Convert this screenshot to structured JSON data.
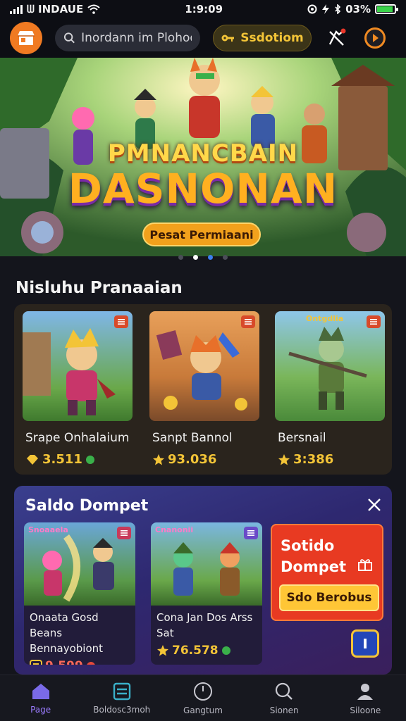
{
  "status_bar": {
    "carrier": "ᗯ INDAUE",
    "time": "1:9:09",
    "battery": "03%",
    "battery_level": 0.9
  },
  "top_bar": {
    "search_placeholder": "Inordann im Plohod",
    "wallet_label": "Ssdotiom",
    "notification_badge": "",
    "colors": {
      "logo": "#f07a22",
      "wallet_text": "#f3c437"
    }
  },
  "hero": {
    "title_line1": "PMNANCBAIN",
    "title_line2": "DASNONAN",
    "cta_label": "Pesat Permiaani",
    "slides": 4,
    "active_slide": 2
  },
  "popular": {
    "title": "Nisluhu Pranaaian",
    "games": [
      {
        "name": "Srape Onhalaium",
        "price": "3.511",
        "icon": "gem-icon"
      },
      {
        "name": "Sanpt Bannol",
        "price": "93.036",
        "icon": "star-icon"
      },
      {
        "name": "Bersnail",
        "price": "3:386",
        "icon": "star-icon",
        "banner": "Ontgdlia"
      }
    ]
  },
  "saldo": {
    "title": "Saldo Dompet",
    "cards": [
      {
        "banner": "Snoaaela",
        "name_line1": "Onaata Gosd Beans",
        "name_line2": "Bennayobiont",
        "price": "9.599",
        "price_color": "#ff6a5a"
      },
      {
        "banner": "Cnanonii",
        "name_line1": "Cona Jan Dos Arss",
        "name_line2": "Sat",
        "price": "76.578",
        "price_color": "#f3c437"
      }
    ],
    "promo": {
      "title_line1": "Sotido",
      "title_line2": "Dompet",
      "button": "Sdo Berobus"
    }
  },
  "bottom_nav": [
    {
      "label": "Page",
      "icon": "home-icon",
      "active": true
    },
    {
      "label": "Boldosc3moh",
      "icon": "wallet-icon",
      "active": false
    },
    {
      "label": "Gangtum",
      "icon": "clock-icon",
      "active": false
    },
    {
      "label": "Sionen",
      "icon": "search-icon",
      "active": false
    },
    {
      "label": "Siloone",
      "icon": "profile-icon",
      "active": false
    }
  ]
}
